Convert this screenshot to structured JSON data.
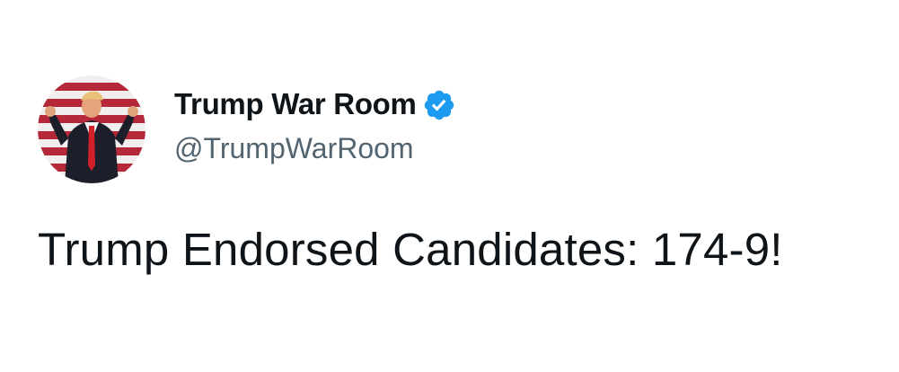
{
  "tweet": {
    "author": {
      "display_name": "Trump War Room",
      "handle": "@TrumpWarRoom",
      "verified": true,
      "avatar_icon": "avatar-photo"
    },
    "text": "Trump Endorsed Candidates: 174-9!"
  },
  "colors": {
    "text_primary": "#0f1419",
    "text_secondary": "#536471",
    "verified_blue": "#1d9bf0",
    "background": "#ffffff"
  }
}
